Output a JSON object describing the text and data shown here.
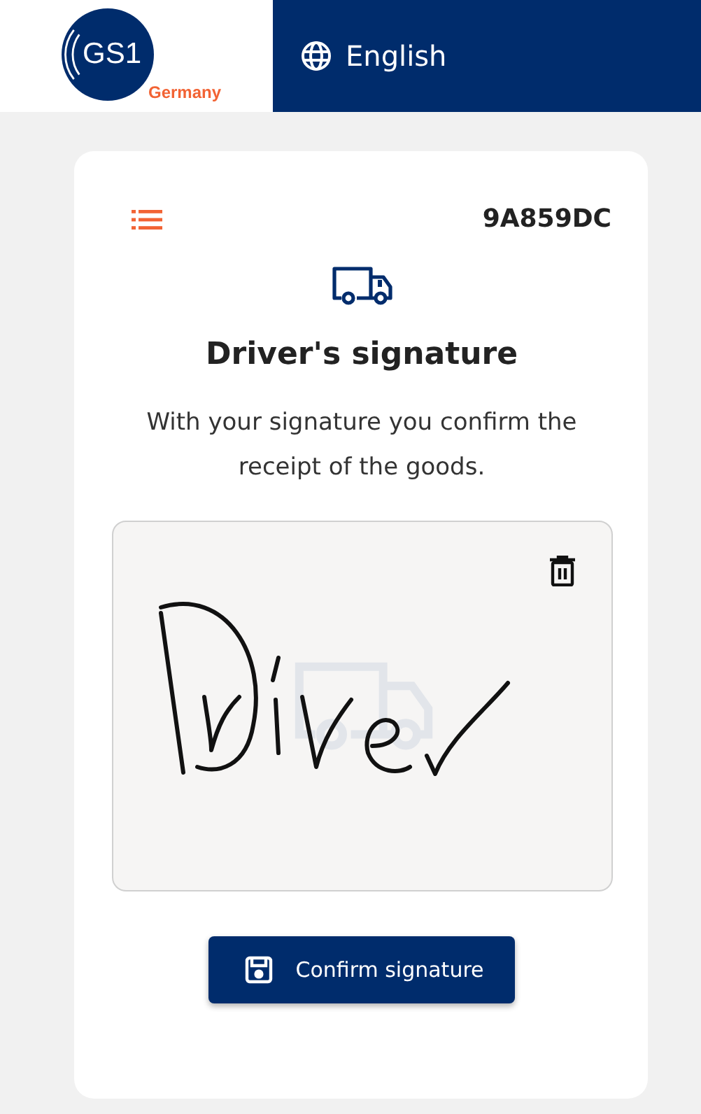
{
  "header": {
    "logo": {
      "mark": "GS1",
      "subtitle": "Germany"
    },
    "language": "English"
  },
  "card": {
    "order_id": "9A859DC",
    "title": "Driver's signature",
    "description": "With your signature you confirm the receipt of the goods."
  },
  "confirm_button": {
    "label": "Confirm signature"
  }
}
